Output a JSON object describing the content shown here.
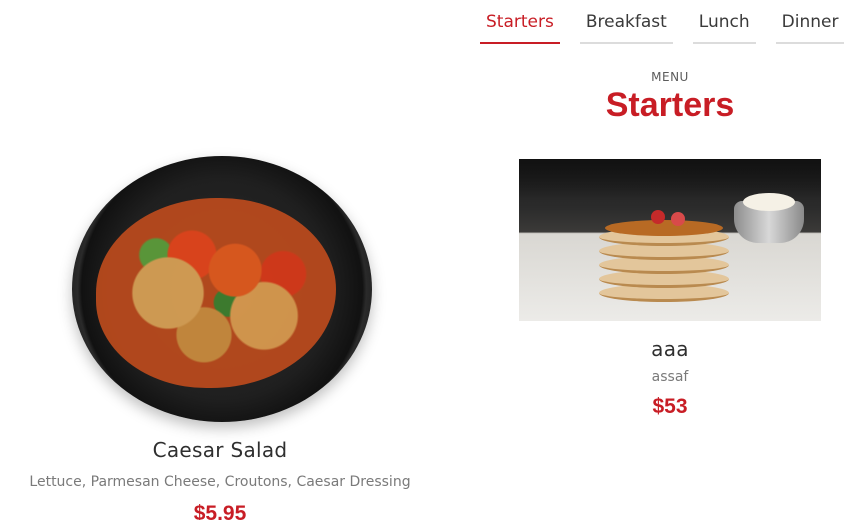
{
  "tabs": [
    {
      "label": "Starters",
      "active": true
    },
    {
      "label": "Breakfast",
      "active": false
    },
    {
      "label": "Lunch",
      "active": false
    },
    {
      "label": "Dinner",
      "active": false
    }
  ],
  "section": {
    "label": "MENU",
    "title": "Starters"
  },
  "items": [
    {
      "name": "Caesar Salad",
      "description": "Lettuce, Parmesan Cheese, Croutons, Caesar Dressing",
      "price": "$5.95",
      "image": "salad-bowl-photo"
    },
    {
      "name": "aaa",
      "description": "assaf",
      "price": "$53",
      "image": "pancake-stack-photo"
    }
  ],
  "colors": {
    "accent": "#c81d25",
    "text": "#2f2f2f",
    "muted": "#7a7a7a"
  }
}
